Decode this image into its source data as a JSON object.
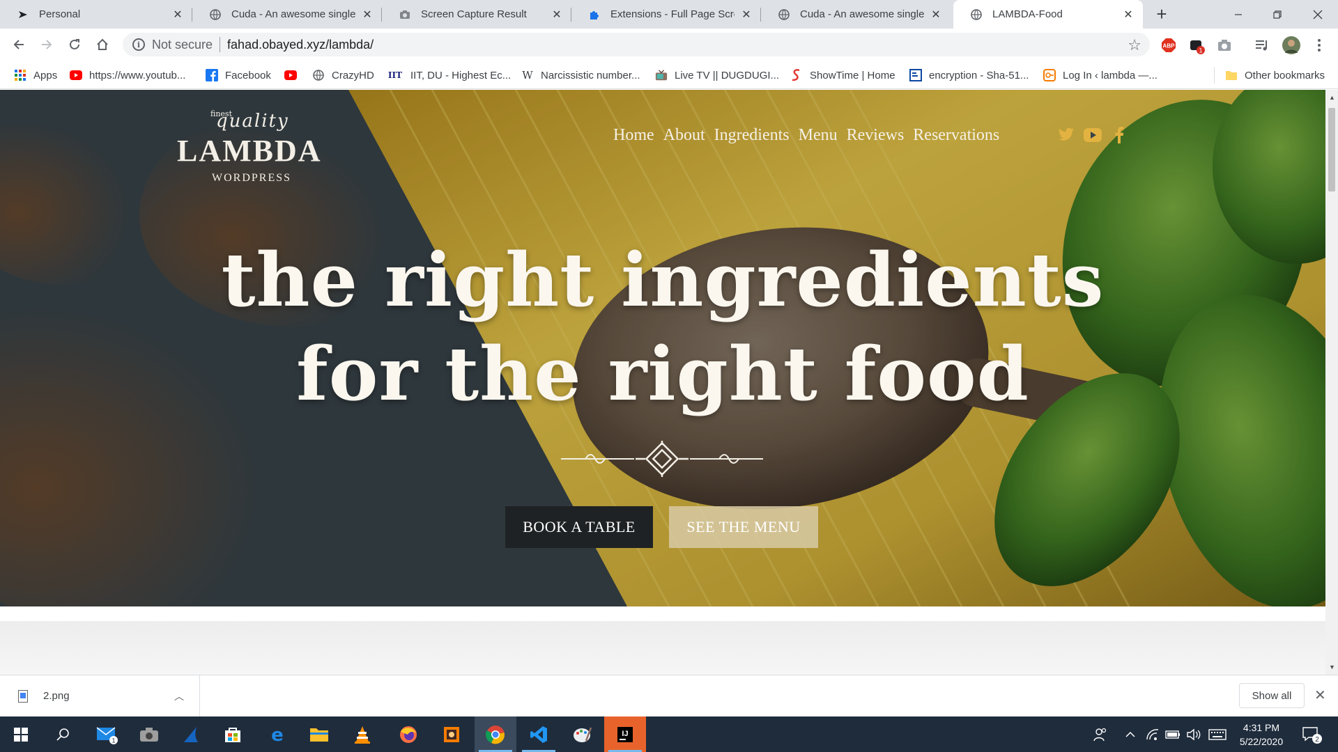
{
  "browser": {
    "tabs": [
      {
        "title": "Personal",
        "icon": "personal-icon",
        "active": false
      },
      {
        "title": "Cuda - An awesome single p",
        "icon": "globe-icon",
        "active": false
      },
      {
        "title": "Screen Capture Result",
        "icon": "camera-icon",
        "active": false
      },
      {
        "title": "Extensions - Full Page Screen",
        "icon": "puzzle-icon",
        "active": false
      },
      {
        "title": "Cuda - An awesome single p",
        "icon": "globe-icon",
        "active": false
      },
      {
        "title": "LAMBDA-Food",
        "icon": "globe-icon",
        "active": true
      }
    ],
    "new_tab": "+",
    "omnibox": {
      "security": "Not secure",
      "url": "fahad.obayed.xyz/lambda/"
    },
    "extensions": [
      {
        "name": "abp-icon",
        "label": "ABP"
      },
      {
        "name": "notification-icon",
        "badge": "1"
      },
      {
        "name": "camera-ext-icon"
      }
    ],
    "bookmarks": [
      {
        "label": "Apps",
        "icon": "apps-grid-icon"
      },
      {
        "label": "https://www.youtub...",
        "icon": "youtube-icon"
      },
      {
        "label": "Facebook",
        "icon": "facebook-icon"
      },
      {
        "label": "",
        "icon": "youtube-icon"
      },
      {
        "label": "CrazyHD",
        "icon": "globe-icon"
      },
      {
        "label": "IIT, DU - Highest Ec...",
        "icon": "iit-icon",
        "icon_text": "IIT"
      },
      {
        "label": "Narcissistic number...",
        "icon": "wikipedia-icon",
        "icon_text": "W"
      },
      {
        "label": "Live TV || DUGDUGI...",
        "icon": "tv-icon"
      },
      {
        "label": "ShowTime | Home",
        "icon": "showtime-icon"
      },
      {
        "label": "encryption - Sha-51...",
        "icon": "encryption-icon"
      },
      {
        "label": "Log In ‹ lambda —...",
        "icon": "login-icon"
      }
    ],
    "other_bookmarks": "Other bookmarks"
  },
  "site": {
    "logo": {
      "top": "quality",
      "small": "finest",
      "name": "LAMBDA",
      "bottom": "WORDPRESS"
    },
    "nav": [
      "Home",
      "About",
      "Ingredients",
      "Menu",
      "Reviews",
      "Reservations"
    ],
    "social": [
      "twitter-icon",
      "youtube-icon",
      "facebook-icon"
    ],
    "headline_line1": "the right ingredients",
    "headline_line2": "for the right food",
    "btn_book": "BOOK A TABLE",
    "btn_menu": "SEE THE MENU"
  },
  "downloads": {
    "file": "2.png",
    "show_all": "Show all"
  },
  "taskbar": {
    "time": "4:31 PM",
    "date": "5/22/2020",
    "mail_badge": "1",
    "notif_badge": "2"
  },
  "colors": {
    "accent_gold": "#e3b341",
    "tab_strip": "#dee1e6",
    "taskbar": "#1f2c3c",
    "book_btn": "#1f2224",
    "menu_btn": "#d6c8a0"
  }
}
